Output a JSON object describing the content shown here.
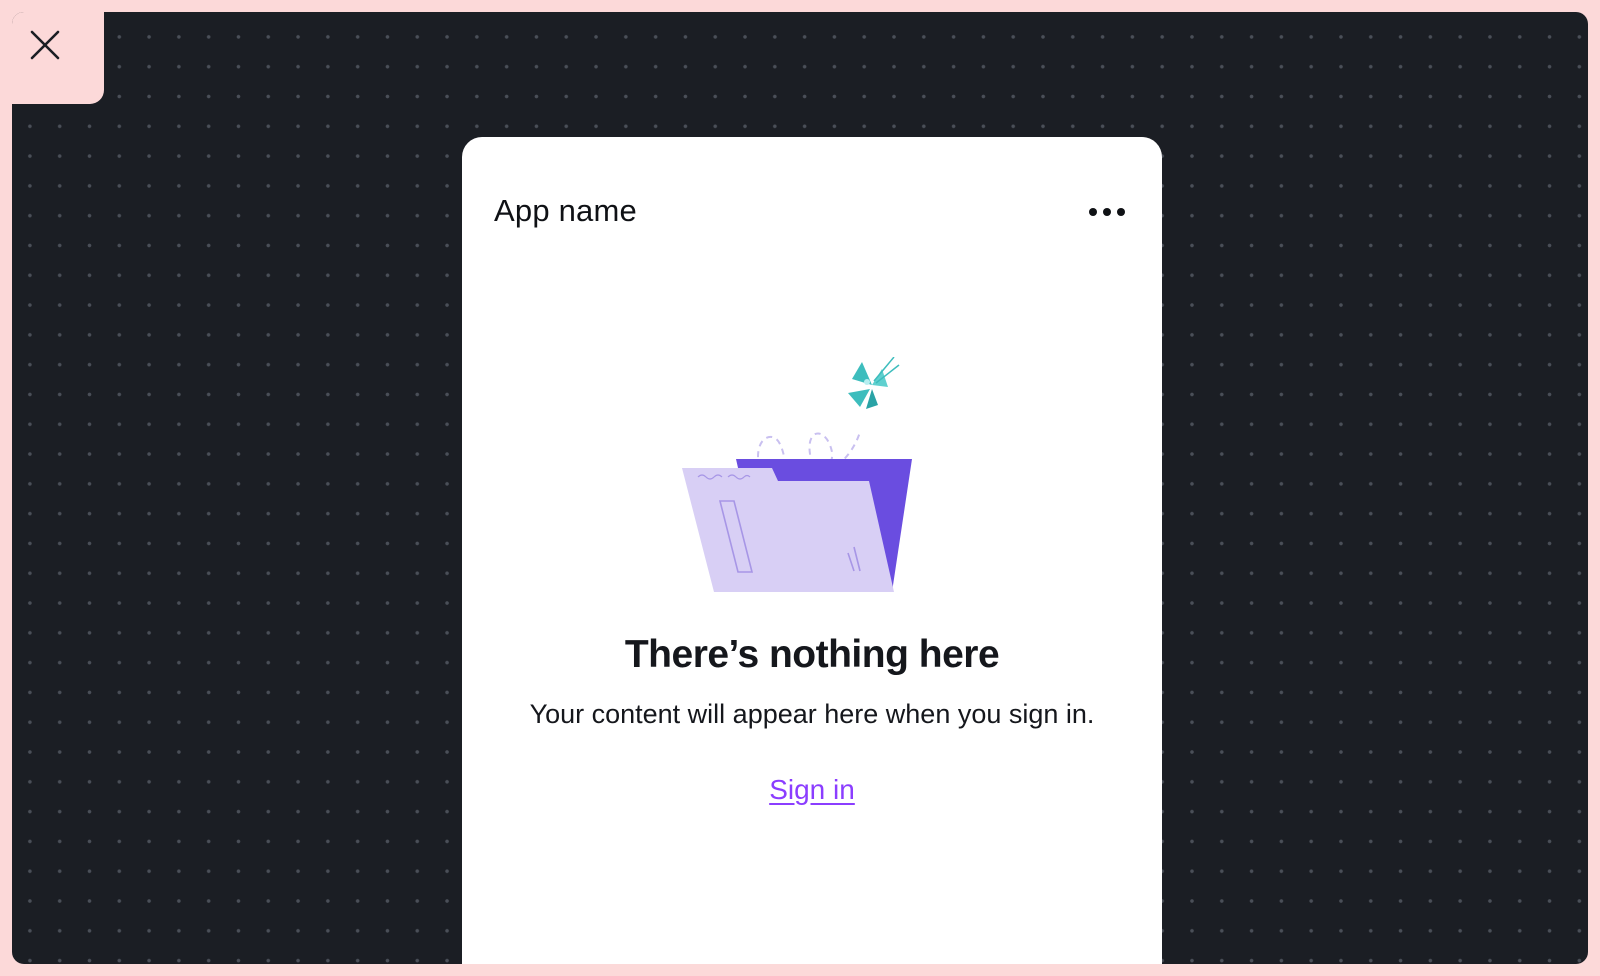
{
  "close_button": {
    "icon": "close-icon"
  },
  "panel": {
    "app_name": "App name",
    "more_icon": "more-horizontal-icon",
    "illustration": "empty-folder-butterfly",
    "empty_state": {
      "title": "There’s nothing here",
      "message": "Your content will appear here when you sign in.",
      "link_label": "Sign in"
    }
  },
  "colors": {
    "frame": "#fcd9d9",
    "canvas": "#1b1e24",
    "link": "#8b3dff",
    "folder_back": "#6a4de0",
    "folder_front": "#d8cff5",
    "butterfly": "#3dbdbd"
  }
}
